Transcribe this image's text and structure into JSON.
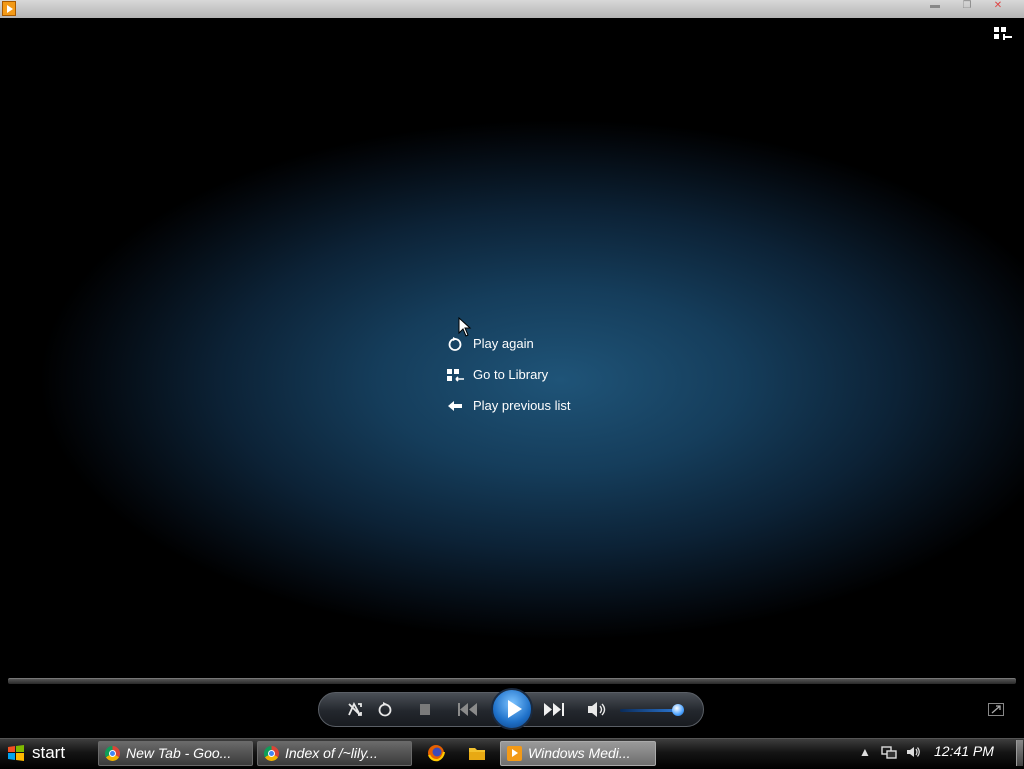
{
  "window": {
    "app_icon": "windows-media-player-icon",
    "buttons": [
      "minimize-icon",
      "restore-icon",
      "close-icon"
    ]
  },
  "top_right": {
    "icon": "switch-to-library-icon"
  },
  "menu": {
    "items": [
      {
        "label": "Play again",
        "icon": "replay-icon"
      },
      {
        "label": "Go to Library",
        "icon": "library-icon"
      },
      {
        "label": "Play previous list",
        "icon": "back-arrow-icon"
      }
    ]
  },
  "controls": {
    "buttons": [
      "shuffle-icon",
      "repeat-icon",
      "stop-icon",
      "previous-icon",
      "play-icon",
      "next-icon",
      "volume-icon"
    ],
    "volume_level": 0.9,
    "accent": "#2f7fe0"
  },
  "taskbar": {
    "start_label": "start",
    "tasks": [
      {
        "label": "New Tab - Goo...",
        "icon": "chrome-icon"
      },
      {
        "label": "Index of /~lily...",
        "icon": "chrome-icon"
      },
      {
        "label": "Windows Medi...",
        "icon": "windows-media-player-icon"
      }
    ],
    "quick_launch": [
      "firefox-icon",
      "file-explorer-icon"
    ],
    "tray": [
      "show-hidden-icons-icon",
      "network-icon",
      "volume-icon"
    ],
    "clock": "12:41 PM"
  }
}
